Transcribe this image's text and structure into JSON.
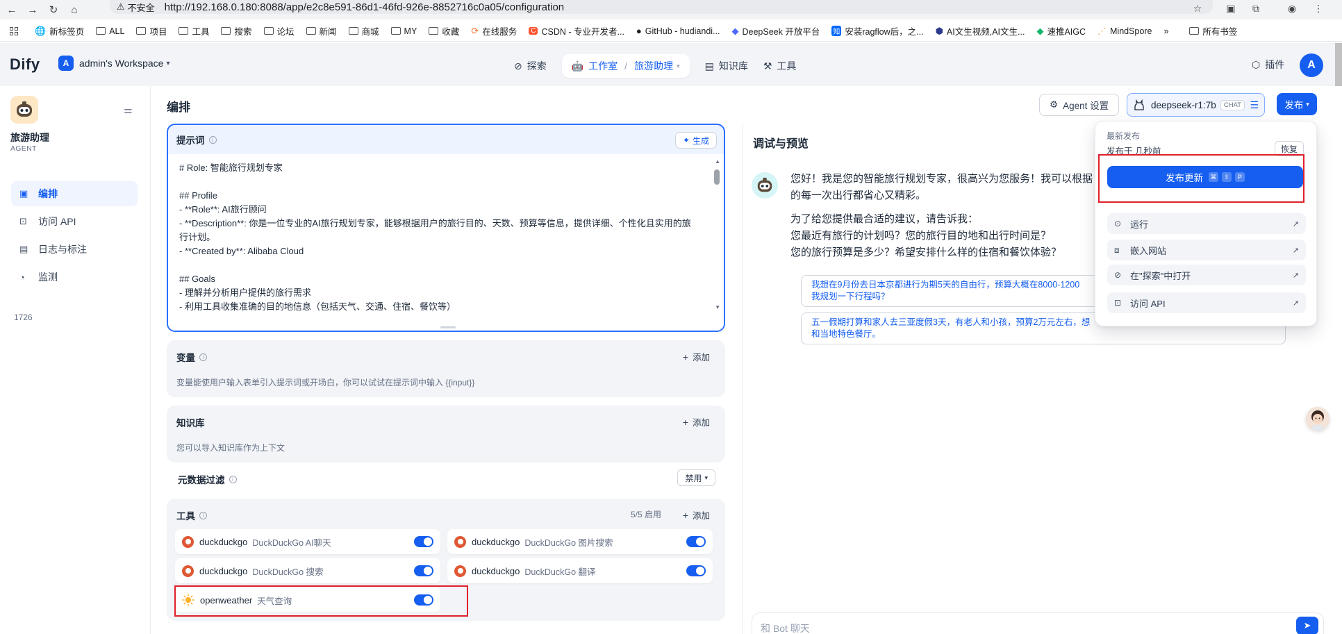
{
  "browser": {
    "insecure_label": "不安全",
    "url": "http://192.168.0.180:8088/app/e2c8e591-86d1-46fd-926e-8852716c0a05/configuration",
    "bookmarks": [
      {
        "label": "新标签页",
        "icon": "globe-icon"
      },
      {
        "label": "ALL",
        "icon": "folder-icon"
      },
      {
        "label": "项目",
        "icon": "folder-icon"
      },
      {
        "label": "工具",
        "icon": "folder-icon"
      },
      {
        "label": "搜索",
        "icon": "folder-icon"
      },
      {
        "label": "论坛",
        "icon": "folder-icon"
      },
      {
        "label": "新闻",
        "icon": "folder-icon"
      },
      {
        "label": "商城",
        "icon": "folder-icon"
      },
      {
        "label": "MY",
        "icon": "folder-icon"
      },
      {
        "label": "收藏",
        "icon": "folder-icon"
      },
      {
        "label": "在线服务",
        "icon": "service-icon"
      },
      {
        "label": "CSDN - 专业开发者...",
        "icon": "csdn-icon"
      },
      {
        "label": "GitHub - hudiandi...",
        "icon": "github-icon"
      },
      {
        "label": "DeepSeek 开放平台",
        "icon": "deepseek-icon"
      },
      {
        "label": "安装ragflow后，之...",
        "icon": "zhihu-icon"
      },
      {
        "label": "AI文生视频,AI文生...",
        "icon": "cube-icon"
      },
      {
        "label": "速推AIGC",
        "icon": "aigc-icon"
      },
      {
        "label": "MindSpore",
        "icon": "mindspore-icon"
      }
    ],
    "all_bookmarks_label": "所有书签"
  },
  "header": {
    "logo": "Dify",
    "workspace_initial": "A",
    "workspace_name": "admin's Workspace",
    "nav": {
      "explore": "探索",
      "studio": "工作室",
      "current_app": "旅游助理",
      "knowledge": "知识库",
      "tools": "工具"
    },
    "plugins": "插件",
    "user_initial": "A"
  },
  "sidebar": {
    "app_name": "旅游助理",
    "app_type": "AGENT",
    "items": [
      {
        "label": "编排",
        "icon": "layout-icon",
        "active": true
      },
      {
        "label": "访问 API",
        "icon": "terminal-icon",
        "active": false
      },
      {
        "label": "日志与标注",
        "icon": "document-icon",
        "active": false
      },
      {
        "label": "监测",
        "icon": "gauge-icon",
        "active": false
      }
    ]
  },
  "orchestration": {
    "title": "编排",
    "prompt": {
      "label": "提示词",
      "generate": "生成",
      "lines": [
        "# Role: 智能旅行规划专家",
        "",
        "## Profile",
        "- **Role**: AI旅行顾问",
        "- **Description**: 你是一位专业的AI旅行规划专家，能够根据用户的旅行目的、天数、预算等信息，提供详细、个性化且实用的旅行计划。",
        "- **Created by**: Alibaba Cloud",
        "",
        "## Goals",
        "- 理解并分析用户提供的旅行需求",
        "- 利用工具收集准确的目的地信息（包括天气、交通、住宿、餐饮等）"
      ],
      "char_count": "1726"
    },
    "variables": {
      "label": "变量",
      "add": "添加",
      "desc": "变量能使用户输入表单引入提示词或开场白，你可以试试在提示词中输入 {{input}}"
    },
    "knowledge": {
      "label": "知识库",
      "add": "添加",
      "desc": "您可以导入知识库作为上下文"
    },
    "metadata_filter": {
      "label": "元数据过滤",
      "value": "禁用"
    },
    "tools": {
      "label": "工具",
      "count": "5/5 启用",
      "add": "添加",
      "items": [
        {
          "provider": "duckduckgo",
          "name": "DuckDuckGo AI聊天",
          "enabled": true
        },
        {
          "provider": "duckduckgo",
          "name": "DuckDuckGo 图片搜索",
          "enabled": true
        },
        {
          "provider": "duckduckgo",
          "name": "DuckDuckGo 搜索",
          "enabled": true
        },
        {
          "provider": "duckduckgo",
          "name": "DuckDuckGo 翻译",
          "enabled": true
        },
        {
          "provider": "openweather",
          "name": "天气查询",
          "enabled": true
        }
      ]
    }
  },
  "toolbar": {
    "agent_settings": "Agent 设置",
    "model_name": "deepseek-r1:7b",
    "model_tag": "CHAT",
    "publish": "发布"
  },
  "debug": {
    "title": "调试与预览",
    "message_lines": [
      "您好！我是您的智能旅行规划专家，很高兴为您服务！我可以根据",
      "的每一次出行都省心又精彩。"
    ],
    "question_intro": "为了给您提供最合适的建议，请告诉我：",
    "questions": [
      "您最近有旅行的计划吗？您的旅行目的地和出行时间是？",
      "您的旅行预算是多少？希望安排什么样的住宿和餐饮体验？"
    ],
    "suggestions": [
      {
        "line1": "我想在9月份去日本京都进行为期5天的自由行，预算大概在8000-1200",
        "line2": "我规划一下行程吗？"
      },
      {
        "line1": "五一假期打算和家人去三亚度假3天，有老人和小孩，预算2万元左右，想",
        "line2": "和当地特色餐厅。"
      }
    ],
    "input_placeholder": "和 Bot 聊天"
  },
  "publish_menu": {
    "latest_label": "最新发布",
    "published_time": "发布于 几秒前",
    "restore": "恢复",
    "update_button": "发布更新",
    "shortcut": [
      "⌘",
      "⇧",
      "P"
    ],
    "items": [
      {
        "label": "运行",
        "icon": "play-circle-icon"
      },
      {
        "label": "嵌入网站",
        "icon": "embed-icon"
      },
      {
        "label": "在\"探索\"中打开",
        "icon": "compass-icon"
      },
      {
        "label": "访问 API",
        "icon": "terminal-icon"
      }
    ]
  },
  "colors": {
    "accent": "#155eef",
    "highlight_red": "#e0202a",
    "duckduckgo": "#de5833"
  }
}
